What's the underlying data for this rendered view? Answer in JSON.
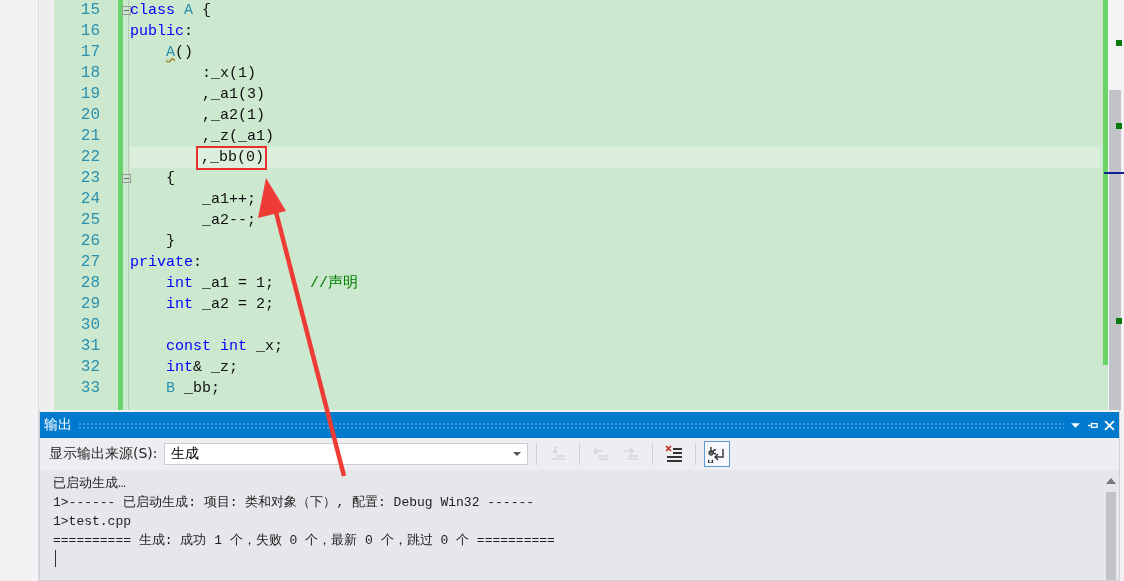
{
  "editor": {
    "lines": [
      {
        "number": "15",
        "fold": true,
        "current": false,
        "marked": false,
        "tokens": [
          {
            "text": "class",
            "kind": "keyword"
          },
          {
            "text": " A",
            "kind": "type"
          },
          {
            "text": " {",
            "kind": "plain"
          }
        ]
      },
      {
        "number": "16",
        "fold": false,
        "current": false,
        "marked": false,
        "tokens": [
          {
            "text": "public",
            "kind": "keyword"
          },
          {
            "text": ":",
            "kind": "plain"
          }
        ]
      },
      {
        "number": "17",
        "fold": false,
        "current": false,
        "marked": false,
        "tokens": [
          {
            "text": "    A",
            "kind": "squiggle"
          },
          {
            "text": "()",
            "kind": "plain"
          }
        ]
      },
      {
        "number": "18",
        "fold": false,
        "current": false,
        "marked": false,
        "tokens": [
          {
            "text": "        :_x(1)",
            "kind": "plain"
          }
        ]
      },
      {
        "number": "19",
        "fold": false,
        "current": false,
        "marked": false,
        "tokens": [
          {
            "text": "        ,_a1(3)",
            "kind": "plain"
          }
        ]
      },
      {
        "number": "20",
        "fold": false,
        "current": false,
        "marked": false,
        "tokens": [
          {
            "text": "        ,_a2(1)",
            "kind": "plain"
          }
        ]
      },
      {
        "number": "21",
        "fold": false,
        "current": false,
        "marked": false,
        "tokens": [
          {
            "text": "        ,_z(_a1)",
            "kind": "plain"
          }
        ]
      },
      {
        "number": "22",
        "fold": false,
        "current": true,
        "marked": true,
        "tokens": [
          {
            "text": "        ,_bb(0)",
            "kind": "plain"
          }
        ]
      },
      {
        "number": "23",
        "fold": true,
        "current": false,
        "marked": false,
        "tokens": [
          {
            "text": "    {",
            "kind": "plain"
          }
        ]
      },
      {
        "number": "24",
        "fold": false,
        "current": false,
        "marked": false,
        "tokens": [
          {
            "text": "        _a1++;",
            "kind": "plain"
          }
        ]
      },
      {
        "number": "25",
        "fold": false,
        "current": false,
        "marked": false,
        "tokens": [
          {
            "text": "        _a2--;",
            "kind": "plain"
          }
        ]
      },
      {
        "number": "26",
        "fold": false,
        "current": false,
        "marked": false,
        "tokens": [
          {
            "text": "    }",
            "kind": "plain"
          }
        ]
      },
      {
        "number": "27",
        "fold": false,
        "current": false,
        "marked": false,
        "tokens": [
          {
            "text": "private",
            "kind": "keyword"
          },
          {
            "text": ":",
            "kind": "plain"
          }
        ]
      },
      {
        "number": "28",
        "fold": false,
        "current": false,
        "marked": false,
        "tokens": [
          {
            "text": "    int",
            "kind": "keyword"
          },
          {
            "text": " _a1 = 1;",
            "kind": "plain"
          },
          {
            "text": "    //声明",
            "kind": "comment"
          }
        ]
      },
      {
        "number": "29",
        "fold": false,
        "current": false,
        "marked": false,
        "tokens": [
          {
            "text": "    int",
            "kind": "keyword"
          },
          {
            "text": " _a2 = 2;",
            "kind": "plain"
          }
        ]
      },
      {
        "number": "30",
        "fold": false,
        "current": false,
        "marked": false
      },
      {
        "number": "31",
        "fold": false,
        "current": false,
        "marked": false,
        "tokens": [
          {
            "text": "    const",
            "kind": "keyword"
          },
          {
            "text": " int",
            "kind": "keyword"
          },
          {
            "text": " _x;",
            "kind": "plain"
          }
        ]
      },
      {
        "number": "32",
        "fold": false,
        "current": false,
        "marked": false,
        "tokens": [
          {
            "text": "    int",
            "kind": "keyword"
          },
          {
            "text": "& _z;",
            "kind": "plain"
          }
        ]
      },
      {
        "number": "33",
        "fold": false,
        "current": false,
        "marked": false,
        "tokens": [
          {
            "text": "    B",
            "kind": "type"
          },
          {
            "text": " _bb;",
            "kind": "plain"
          }
        ]
      }
    ]
  },
  "output": {
    "title": "输出",
    "source_label": "显示输出来源(S):",
    "source_value": "生成",
    "toolbar": [
      {
        "kind": "goto",
        "disabled": true,
        "on": false
      },
      {
        "kind": "prev",
        "disabled": true,
        "on": false
      },
      {
        "kind": "next",
        "disabled": true,
        "on": false
      },
      {
        "kind": "clear",
        "disabled": false,
        "on": false
      },
      {
        "kind": "wrap",
        "disabled": false,
        "on": true
      }
    ],
    "lines": [
      "已启动生成…",
      "1>------ 已启动生成: 项目: 类和对象（下）, 配置: Debug Win32 ------",
      "1>test.cpp",
      "========== 生成: 成功 1 个，失败 0 个，最新 0 个，跳过 0 个 =========="
    ]
  }
}
